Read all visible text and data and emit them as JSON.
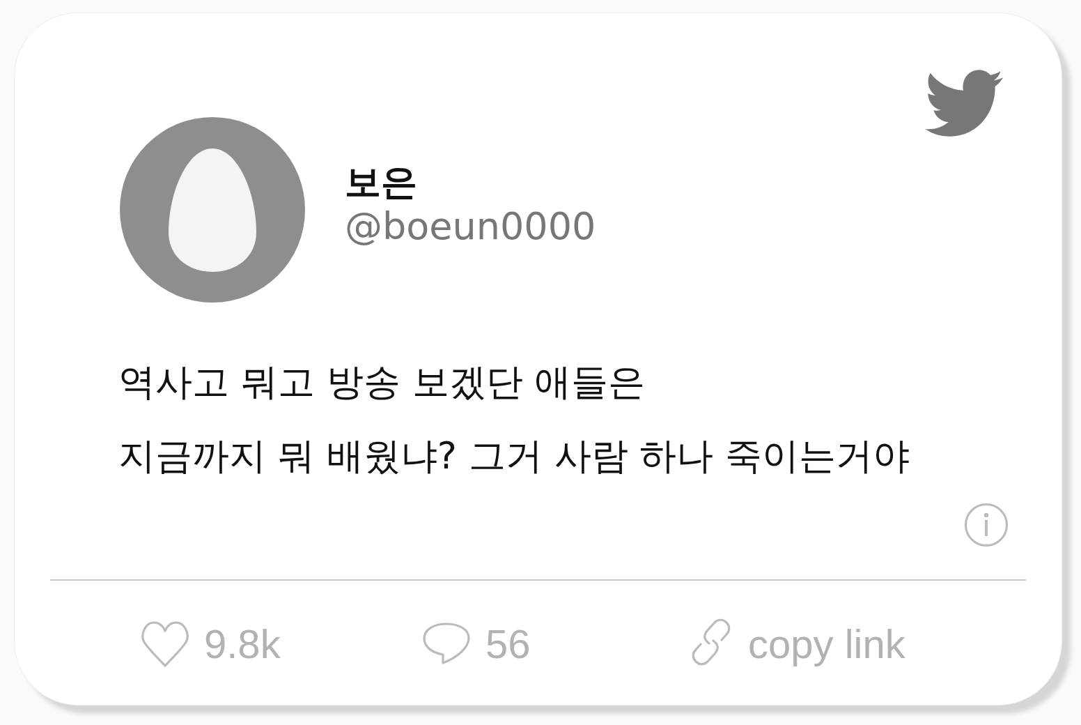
{
  "author": {
    "name": "보은",
    "handle": "@boeun0000"
  },
  "tweet": {
    "lines": [
      "역사고 뭐고 방송 보겠단 애들은",
      "지금까지 뭐 배웠냐? 그거 사람 하나 죽이는거야"
    ]
  },
  "actions": [
    {
      "kind": "like",
      "label": "9.8k"
    },
    {
      "kind": "reply",
      "label": "56"
    },
    {
      "kind": "link",
      "label": "copy link"
    }
  ]
}
